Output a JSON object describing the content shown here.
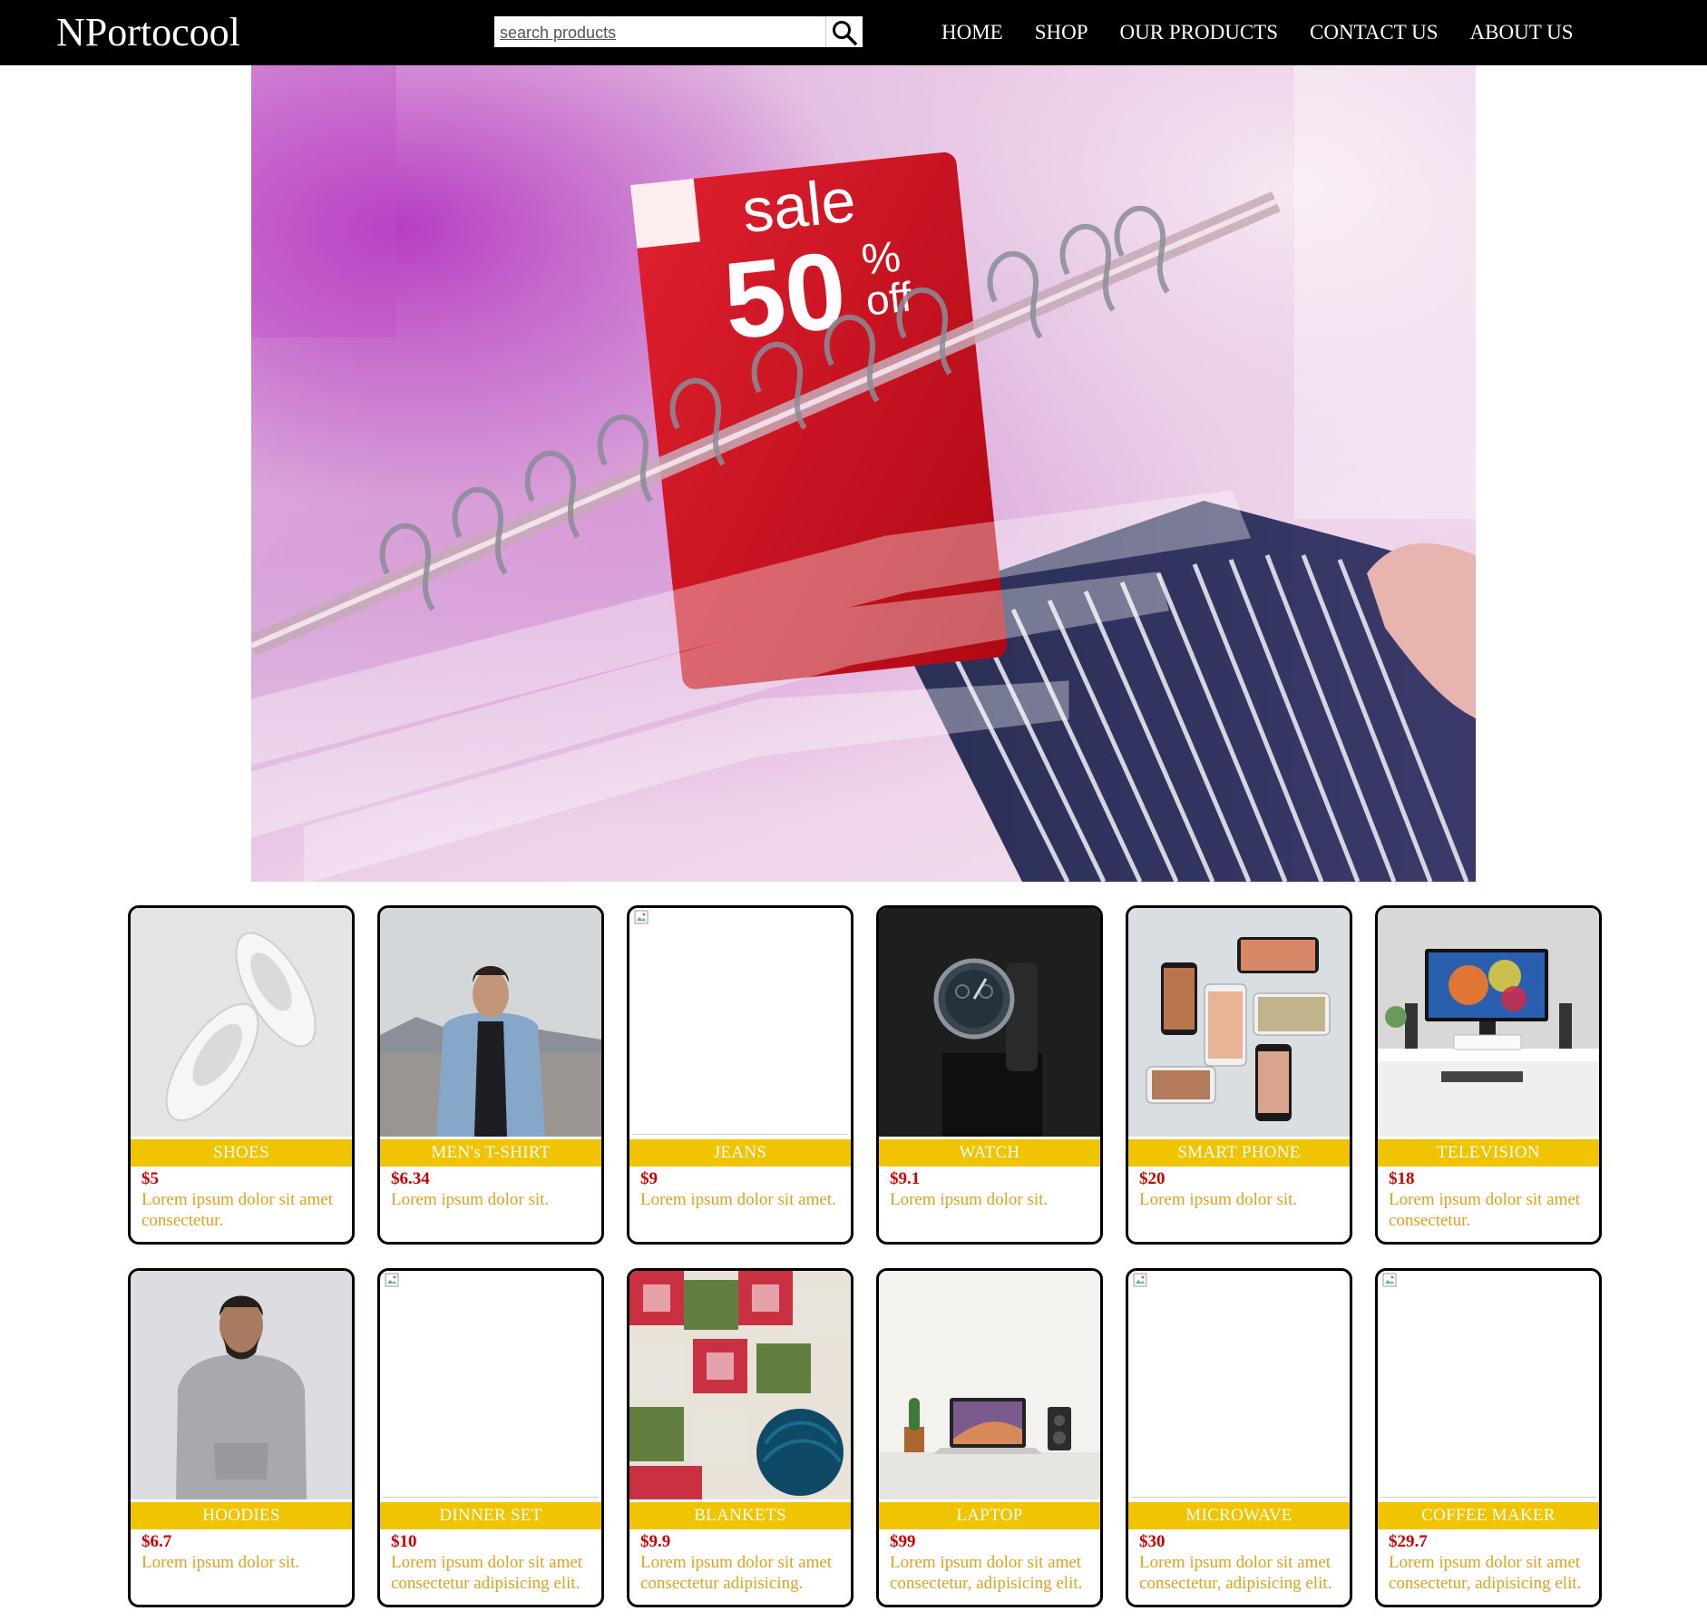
{
  "navbar": {
    "logo": "NPortocool",
    "search_placeholder": "search products",
    "links": [
      "HOME",
      "SHOP",
      "OUR PRODUCTS",
      "CONTACT US",
      "ABOUT US"
    ]
  },
  "hero": {
    "sign_line1": "sale",
    "sign_line2": "50",
    "sign_percent": "%",
    "sign_off": "off"
  },
  "products": [
    {
      "title": "SHOES",
      "price": "$5",
      "desc": "Lorem ipsum dolor sit amet consectetur."
    },
    {
      "title": "MEN's T-SHIRT",
      "price": "$6.34",
      "desc": "Lorem ipsum dolor sit."
    },
    {
      "title": "JEANS",
      "price": "$9",
      "desc": "Lorem ipsum dolor sit amet."
    },
    {
      "title": "WATCH",
      "price": "$9.1",
      "desc": "Lorem ipsum dolor sit."
    },
    {
      "title": "SMART PHONE",
      "price": "$20",
      "desc": "Lorem ipsum dolor sit."
    },
    {
      "title": "TELEVISION",
      "price": "$18",
      "desc": "Lorem ipsum dolor sit amet consectetur."
    },
    {
      "title": "HOODIES",
      "price": "$6.7",
      "desc": "Lorem ipsum dolor sit."
    },
    {
      "title": "DINNER SET",
      "price": "$10",
      "desc": "Lorem ipsum dolor sit amet consectetur adipisicing elit."
    },
    {
      "title": "BLANKETS",
      "price": "$9.9",
      "desc": "Lorem ipsum dolor sit amet consectetur adipisicing."
    },
    {
      "title": "LAPTOP",
      "price": "$99",
      "desc": "Lorem ipsum dolor sit amet consectetur, adipisicing elit."
    },
    {
      "title": "MICROWAVE",
      "price": "$30",
      "desc": "Lorem ipsum dolor sit amet consectetur, adipisicing elit."
    },
    {
      "title": "COFFEE MAKER",
      "price": "$29.7",
      "desc": "Lorem ipsum dolor sit amet consectetur, adipisicing elit."
    }
  ],
  "colors": {
    "navbar_bg": "#000000",
    "title_band": "#f0c400",
    "price": "#d10000",
    "description": "#e0a020",
    "sale_sign": "#d4101a"
  }
}
